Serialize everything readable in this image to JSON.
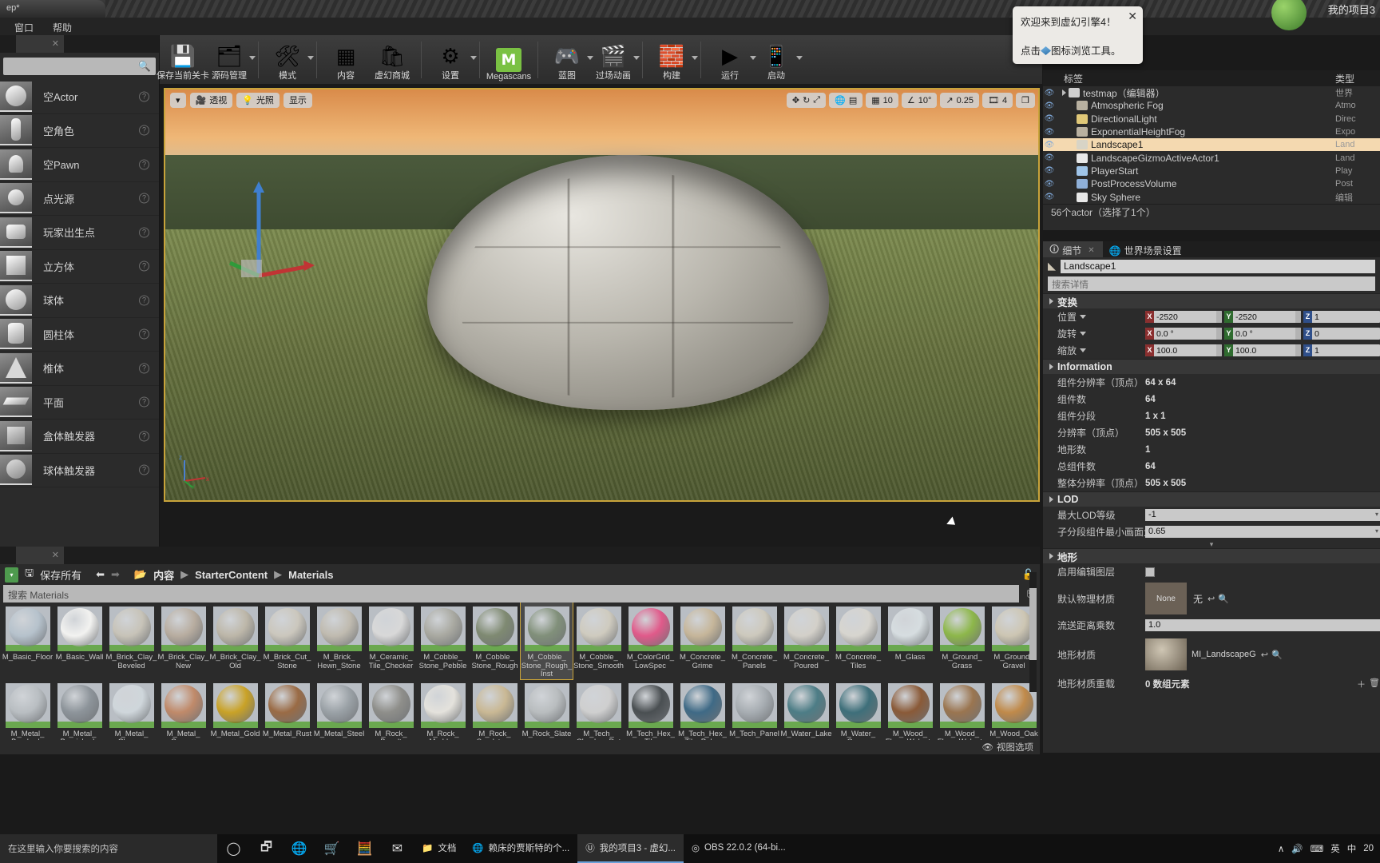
{
  "window": {
    "title_tab": "ep*",
    "project_label": "我的项目3",
    "menus": [
      {
        "label": "窗口",
        "x": 18
      },
      {
        "label": "帮助",
        "x": 66
      }
    ]
  },
  "welcome": {
    "line1": "欢迎来到虚幻引擎4！",
    "line2_before": "点击",
    "line2_after": "图标浏览工具。",
    "close": "✕"
  },
  "toolbar": {
    "groups": [
      {
        "items": [
          {
            "label": "保存当前关卡",
            "icon": "save-icon",
            "glyph": "💾",
            "caret": false
          },
          {
            "label": "源码管理",
            "icon": "source-control-icon",
            "glyph": "🗂",
            "caret": true
          }
        ]
      },
      {
        "items": [
          {
            "label": "模式",
            "icon": "modes-icon",
            "glyph": "🛠",
            "caret": true
          }
        ]
      },
      {
        "items": [
          {
            "label": "内容",
            "icon": "content-icon",
            "glyph": "▦",
            "caret": false
          },
          {
            "label": "虚幻商城",
            "icon": "marketplace-icon",
            "glyph": "🛍",
            "caret": false
          }
        ]
      },
      {
        "items": [
          {
            "label": "设置",
            "icon": "settings-gear-icon",
            "glyph": "⚙",
            "caret": true
          }
        ]
      },
      {
        "items": [
          {
            "label": "Megascans",
            "icon": "megascans-icon",
            "glyph": "M",
            "caret": false
          }
        ]
      },
      {
        "items": [
          {
            "label": "蓝图",
            "icon": "blueprint-icon",
            "glyph": "🎮",
            "caret": true
          },
          {
            "label": "过场动画",
            "icon": "cinematics-icon",
            "glyph": "🎬",
            "caret": true
          }
        ]
      },
      {
        "items": [
          {
            "label": "构建",
            "icon": "build-icon",
            "glyph": "🧱",
            "caret": true
          }
        ]
      },
      {
        "items": [
          {
            "label": "运行",
            "icon": "play-icon",
            "glyph": "▶",
            "caret": true
          },
          {
            "label": "启动",
            "icon": "launch-icon",
            "glyph": "📱",
            "caret": true
          }
        ]
      }
    ]
  },
  "place_panel": {
    "search_placeholder": "",
    "items": [
      {
        "label": "空Actor",
        "icon": "empty-actor-icon"
      },
      {
        "label": "空角色",
        "icon": "empty-character-icon"
      },
      {
        "label": "空Pawn",
        "icon": "empty-pawn-icon"
      },
      {
        "label": "点光源",
        "icon": "point-light-icon"
      },
      {
        "label": "玩家出生点",
        "icon": "player-start-icon"
      },
      {
        "label": "立方体",
        "icon": "cube-icon"
      },
      {
        "label": "球体",
        "icon": "sphere-icon"
      },
      {
        "label": "圆柱体",
        "icon": "cylinder-icon"
      },
      {
        "label": "椎体",
        "icon": "cone-icon"
      },
      {
        "label": "平面",
        "icon": "plane-icon"
      },
      {
        "label": "盒体触发器",
        "icon": "box-trigger-icon"
      },
      {
        "label": "球体触发器",
        "icon": "sphere-trigger-icon"
      }
    ],
    "help_glyph": "?"
  },
  "viewport": {
    "left_pills": [
      {
        "label": "透视",
        "icon": "camera-icon"
      },
      {
        "label": "光照",
        "icon": "lighting-icon"
      },
      {
        "label": "显示",
        "icon": "show-icon"
      }
    ],
    "menu_caret": "▾",
    "right_controls": [
      {
        "name": "translate-snap",
        "value": "10"
      },
      {
        "name": "rotate-snap",
        "value": "10°"
      },
      {
        "name": "scale-snap",
        "value": "0.25"
      },
      {
        "name": "camera-speed",
        "value": "4"
      }
    ]
  },
  "outliner": {
    "col_label": "标签",
    "col_type": "类型",
    "rows": [
      {
        "name": "testmap（编辑器）",
        "type": "世界",
        "indent": 0,
        "selected": false,
        "icon": "world-icon"
      },
      {
        "name": "Atmospheric Fog",
        "type": "Atmo",
        "indent": 1,
        "selected": false,
        "icon": "fog-icon"
      },
      {
        "name": "DirectionalLight",
        "type": "Direc",
        "indent": 1,
        "selected": false,
        "icon": "light-icon"
      },
      {
        "name": "ExponentialHeightFog",
        "type": "Expo",
        "indent": 1,
        "selected": false,
        "icon": "fog-icon"
      },
      {
        "name": "Landscape1",
        "type": "Land",
        "indent": 1,
        "selected": true,
        "icon": "landscape-icon"
      },
      {
        "name": "LandscapeGizmoActiveActor1",
        "type": "Land",
        "indent": 1,
        "selected": false,
        "icon": "gizmo-icon"
      },
      {
        "name": "PlayerStart",
        "type": "Play",
        "indent": 1,
        "selected": false,
        "icon": "player-start-icon"
      },
      {
        "name": "PostProcessVolume",
        "type": "Post",
        "indent": 1,
        "selected": false,
        "icon": "volume-icon"
      },
      {
        "name": "Sky Sphere",
        "type": "编辑",
        "indent": 1,
        "selected": false,
        "icon": "sky-icon"
      }
    ],
    "footer": "56个actor（选择了1个）"
  },
  "details": {
    "tabs": [
      {
        "label": "细节",
        "icon": "details-icon",
        "active": true,
        "close": "✕"
      },
      {
        "label": "世界场景设置",
        "icon": "world-settings-icon",
        "active": false
      }
    ],
    "actor_name": "Landscape1",
    "search_placeholder": "搜索详情",
    "transform": {
      "title": "变换",
      "rows": [
        {
          "key": "位置",
          "x": "-2520",
          "y": "-2520",
          "z": "1"
        },
        {
          "key": "旋转",
          "x": "0.0 °",
          "y": "0.0 °",
          "z": "0"
        },
        {
          "key": "缩放",
          "x": "100.0",
          "y": "100.0",
          "z": "1"
        }
      ]
    },
    "information": {
      "title": "Information",
      "rows": [
        {
          "key": "组件分辨率（顶点）",
          "value": "64 x 64"
        },
        {
          "key": "组件数",
          "value": "64"
        },
        {
          "key": "组件分段",
          "value": "1 x 1"
        },
        {
          "key": "分辨率（顶点）",
          "value": "505 x 505"
        },
        {
          "key": "地形数",
          "value": "1"
        },
        {
          "key": "总组件数",
          "value": "64"
        },
        {
          "key": "整体分辨率（顶点）",
          "value": "505 x 505"
        }
      ]
    },
    "lod": {
      "title": "LOD",
      "rows": [
        {
          "key": "最大LOD等级",
          "value": "-1"
        },
        {
          "key": "子分段组件最小画面大",
          "value": "0.65"
        }
      ]
    },
    "terrain": {
      "title": "地形",
      "enable_edit_layers_label": "启用编辑图层",
      "default_phys_material_label": "默认物理材质",
      "default_phys_material_value": "None",
      "default_phys_material_none": "无",
      "streaming_label": "流送距离乘数",
      "streaming_value": "1.0",
      "landscape_material_label": "地形材质",
      "landscape_material_value": "MI_LandscapeG",
      "material_override_label": "地形材质重载",
      "material_override_value": "0 数组元素"
    }
  },
  "content_browser": {
    "save_all": "保存所有",
    "breadcrumbs": [
      "内容",
      "StarterContent",
      "Materials"
    ],
    "crumb_sep": "▶",
    "search_placeholder": "搜索 Materials",
    "view_options": "视图选项",
    "assets": [
      {
        "name": "M_Basic_Floor",
        "color": "#b6c2cc"
      },
      {
        "name": "M_Basic_Wall",
        "color": "#f2f2f0"
      },
      {
        "name": "M_Brick_Clay_Beveled",
        "color": "#c7c3b8"
      },
      {
        "name": "M_Brick_Clay_New",
        "color": "#b8ada0"
      },
      {
        "name": "M_Brick_Clay_Old",
        "color": "#bdb7a9"
      },
      {
        "name": "M_Brick_Cut_Stone",
        "color": "#cbc7bd"
      },
      {
        "name": "M_Brick_Hewn_Stone",
        "color": "#c0bbb0"
      },
      {
        "name": "M_Ceramic_Tile_Checker",
        "color": "#d8d8d8"
      },
      {
        "name": "M_Cobble_Stone_Pebble",
        "color": "#a9a9a1"
      },
      {
        "name": "M_Cobble_Stone_Rough",
        "color": "#7f8a72"
      },
      {
        "name": "M_Cobble_Stone_Rough_Inst",
        "color": "#81907a",
        "selected": true
      },
      {
        "name": "M_Cobble_Stone_Smooth",
        "color": "#cfcbbf"
      },
      {
        "name": "M_ColorGrid_LowSpec",
        "color": "#e05a8a"
      },
      {
        "name": "M_Concrete_Grime",
        "color": "#c6b69a"
      },
      {
        "name": "M_Concrete_Panels",
        "color": "#cdc9bd"
      },
      {
        "name": "M_Concrete_Poured",
        "color": "#d3d0c9"
      },
      {
        "name": "M_Concrete_Tiles",
        "color": "#d7d5cf"
      },
      {
        "name": "M_Glass",
        "color": "#d6dde0"
      },
      {
        "name": "M_Ground_Grass",
        "color": "#8db74a"
      },
      {
        "name": "M_Ground_Gravel",
        "color": "#cdc6b3"
      },
      {
        "name": "M_Metal_Brushed_Nickel",
        "color": "#b9bec2"
      },
      {
        "name": "M_Metal_Burnished_Steel",
        "color": "#8d949a"
      },
      {
        "name": "M_Metal_Chrome",
        "color": "#cfd6db"
      },
      {
        "name": "M_Metal_Copper",
        "color": "#c08a6a"
      },
      {
        "name": "M_Metal_Gold",
        "color": "#c9a227"
      },
      {
        "name": "M_Metal_Rust",
        "color": "#9a6b45"
      },
      {
        "name": "M_Metal_Steel",
        "color": "#9aa1a6"
      },
      {
        "name": "M_Rock_Basalt",
        "color": "#8e8e8a"
      },
      {
        "name": "M_Rock_Marble_Polished",
        "color": "#e4e2dc"
      },
      {
        "name": "M_Rock_Sandstone",
        "color": "#c9b894"
      },
      {
        "name": "M_Rock_Slate",
        "color": "#b9bdbf"
      },
      {
        "name": "M_Tech_Checker_Dot",
        "color": "#cfcfcf"
      },
      {
        "name": "M_Tech_Hex_Tile",
        "color": "#4a4f52"
      },
      {
        "name": "M_Tech_Hex_Tile_Pulse",
        "color": "#3f6a86"
      },
      {
        "name": "M_Tech_Panel",
        "color": "#a7adb2"
      },
      {
        "name": "M_Water_Lake",
        "color": "#4d7d86"
      },
      {
        "name": "M_Water_Ocean",
        "color": "#3e6f7a"
      },
      {
        "name": "M_Wood_Floor_Walnut_Polished",
        "color": "#8a5a38"
      },
      {
        "name": "M_Wood_Floor_Walnut_Worn",
        "color": "#9a7550"
      },
      {
        "name": "M_Wood_Oak",
        "color": "#c08a4a"
      }
    ]
  },
  "taskbar": {
    "search_placeholder": "在这里输入你要搜索的内容",
    "quick_icons": [
      {
        "name": "cortana-icon",
        "glyph": "◯"
      },
      {
        "name": "task-view-icon",
        "glyph": "🗗"
      },
      {
        "name": "edge-icon",
        "glyph": "🌐"
      },
      {
        "name": "store-icon",
        "glyph": "🛒"
      },
      {
        "name": "calculator-icon",
        "glyph": "🧮"
      },
      {
        "name": "mail-icon",
        "glyph": "✉"
      }
    ],
    "apps": [
      {
        "label": "文档",
        "icon": "folder-icon",
        "active": false
      },
      {
        "label": "赖床的贾斯特的个...",
        "icon": "browser-icon",
        "active": false
      },
      {
        "label": "我的项目3 - 虚幻...",
        "icon": "unreal-icon",
        "active": true
      },
      {
        "label": "OBS 22.0.2 (64-bi...",
        "icon": "obs-icon",
        "active": false
      }
    ],
    "tray": [
      "∧",
      "🔊",
      "⌨",
      "英",
      "中",
      "20"
    ]
  }
}
